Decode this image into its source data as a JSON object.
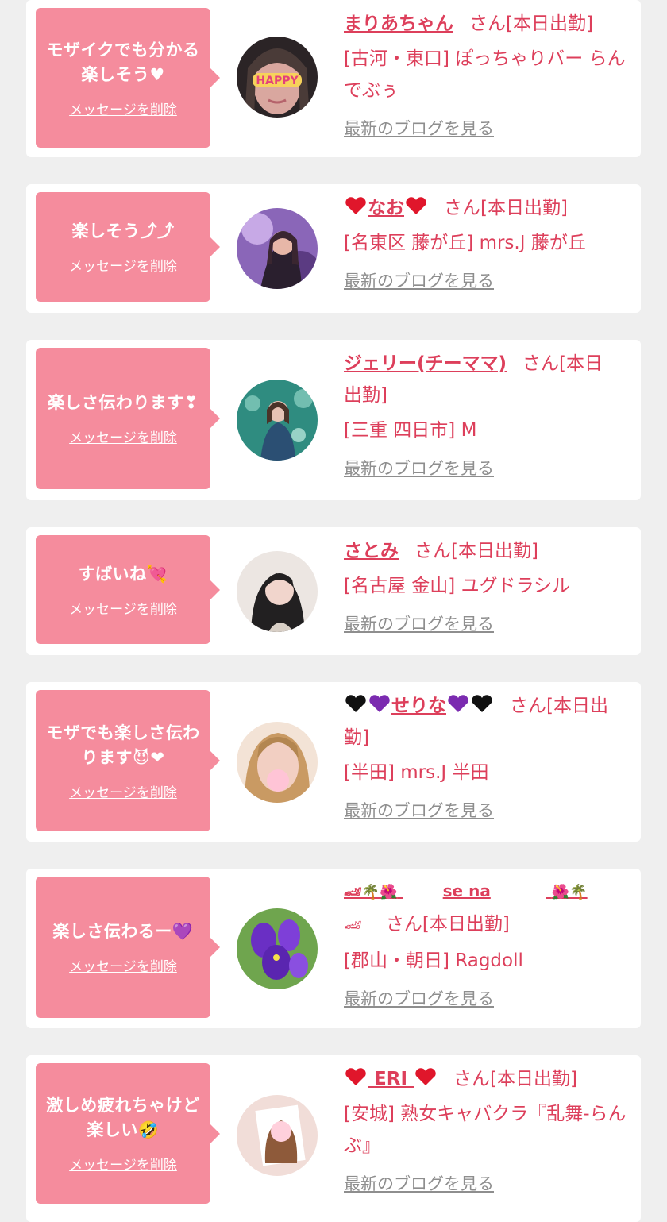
{
  "colors": {
    "page_bg": "#efefef",
    "card_bg": "#ffffff",
    "bubble": "#f58c9d",
    "accent": "#dd3f5b",
    "link_gray": "#8e8e8e"
  },
  "delete_label": "メッセージを削除",
  "blog_label": "最新のブログを見る",
  "suffix_single": "さん[本日出勤]",
  "cards": [
    {
      "message": "モザイクでも分かる楽しそう♥",
      "name": "まりあちゃん",
      "shop": "[古河・東口] ぽっちゃりバー らんでぶぅ",
      "avatar_text": "HAPPY"
    },
    {
      "message": "楽しそう⤴⤴",
      "name": "なお",
      "shop": "[名東区 藤が丘] mrs.J 藤が丘"
    },
    {
      "message": "楽しさ伝わります❣",
      "name": "ジェリー(チーママ)",
      "suffix_a": "さん[本日",
      "suffix_b": "出勤]",
      "shop": "[三重 四日市] M"
    },
    {
      "message": "すばいね💘",
      "name": "さとみ",
      "shop": "[名古屋 金山] ユグドラシル"
    },
    {
      "message": "モザでも楽しさ伝わります😈❤",
      "name": "せりな",
      "suffix_a": "さん[本日出",
      "suffix_b": "勤]",
      "shop": "[半田] mrs.J 半田"
    },
    {
      "message": "楽しさ伝わるー💜",
      "name": "se na",
      "shop": "[郡山・朝日] Ragdoll"
    },
    {
      "message": "激しめ疲れちゃけど楽しい🤣",
      "name": "ERI",
      "shop": "[安城] 熟女キャバクラ『乱舞-らんぶ』"
    }
  ]
}
